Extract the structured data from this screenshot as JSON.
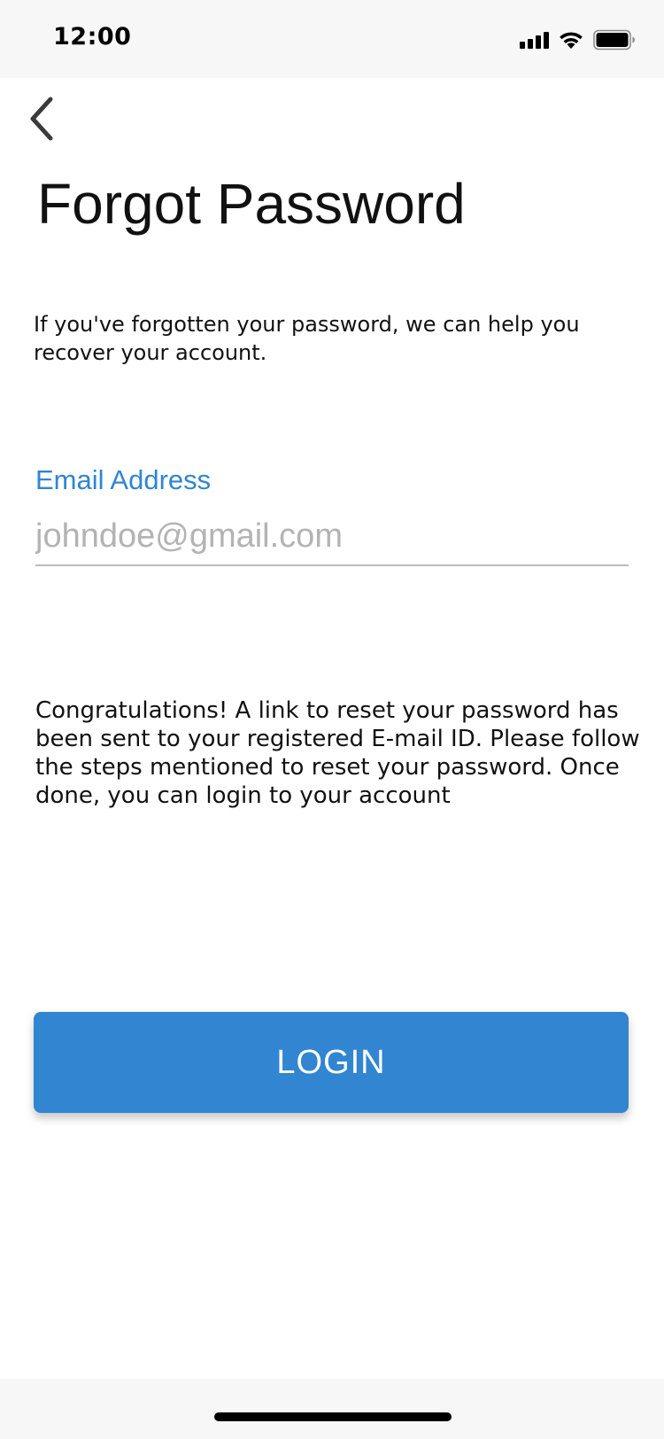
{
  "status_bar": {
    "time": "12:00"
  },
  "header": {
    "back_icon": "chevron-left-icon",
    "title": "Forgot Password"
  },
  "intro": {
    "text": "If you've forgotten your password, we can help you recover your account."
  },
  "email": {
    "label": "Email Address",
    "placeholder": "johndoe@gmail.com",
    "value": ""
  },
  "message": {
    "text": "Congratulations! A link to reset your password has been sent to your registered E-mail ID. Please follow the steps mentioned to reset your password. Once done, you can login to your account"
  },
  "actions": {
    "login_label": "LOGIN"
  },
  "colors": {
    "accent": "#3185d1",
    "text": "#111111",
    "placeholder": "#b3b3b3",
    "status_bar_bg": "#f7f7f7"
  }
}
